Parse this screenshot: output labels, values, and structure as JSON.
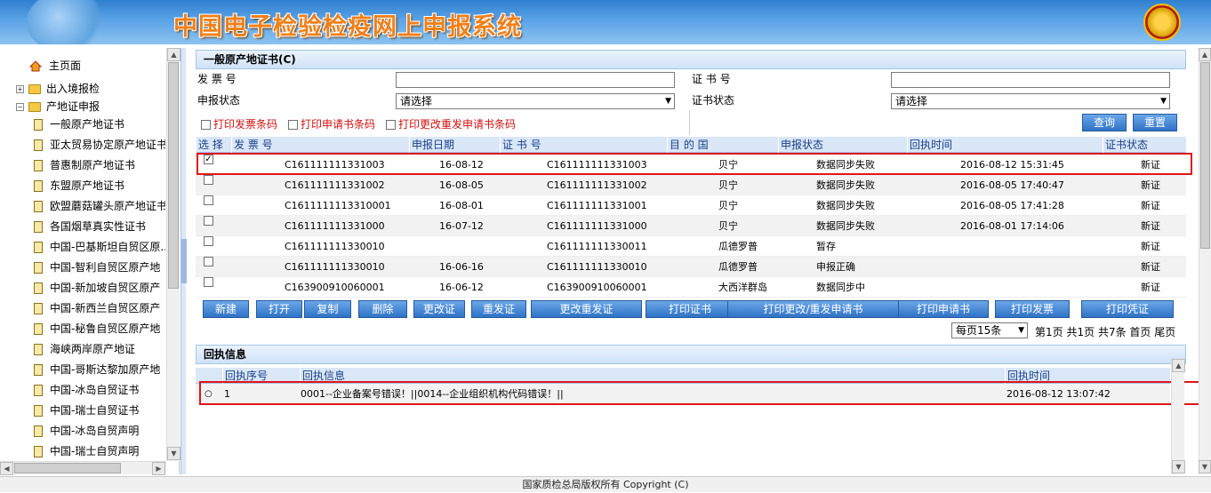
{
  "app": {
    "title": "中国电子检验检疫网上申报系统"
  },
  "sidebar": {
    "items": [
      {
        "label": "主页面"
      },
      {
        "label": "出入境报检"
      },
      {
        "label": "产地证申报"
      },
      {
        "label": "一般原产地证书"
      },
      {
        "label": "亚太贸易协定原产地证书"
      },
      {
        "label": "普惠制原产地证书"
      },
      {
        "label": "东盟原产地证书"
      },
      {
        "label": "欧盟蘑菇罐头原产地证书"
      },
      {
        "label": "各国烟草真实性证书"
      },
      {
        "label": "中国-巴基斯坦自贸区原..."
      },
      {
        "label": "中国-智利自贸区原产地"
      },
      {
        "label": "中国-新加坡自贸区原产"
      },
      {
        "label": "中国-新西兰自贸区原产"
      },
      {
        "label": "中国-秘鲁自贸区原产地"
      },
      {
        "label": "海峡两岸原产地证"
      },
      {
        "label": "中国-哥斯达黎加原产地"
      },
      {
        "label": "中国-冰岛自贸证书"
      },
      {
        "label": "中国-瑞士自贸证书"
      },
      {
        "label": "中国-冰岛自贸声明"
      },
      {
        "label": "中国-瑞士自贸声明"
      }
    ]
  },
  "form": {
    "panel_title": "一般原产地证书(C)",
    "invoice_label": "发 票 号",
    "invoice_value": "",
    "cert_label": "证 书 号",
    "cert_value": "",
    "apply_status_label": "申报状态",
    "apply_status_value": "请选择",
    "cert_status_label": "证书状态",
    "cert_status_value": "请选择",
    "print_invoice_barcode": "打印发票条码",
    "print_apply_barcode": "打印申请书条码",
    "print_change_barcode": "打印更改重发申请书条码",
    "query_button": "查询",
    "reset_button": "重置"
  },
  "table": {
    "headers": [
      "选 择",
      "发 票 号",
      "申报日期",
      "证 书 号",
      "目 的 国",
      "申报状态",
      "回执时间",
      "证书状态"
    ],
    "rows": [
      {
        "checked": true,
        "invoice": "C161111111331003",
        "date": "16-08-12",
        "cert": "C161111111331003",
        "country": "贝宁",
        "status": "数据同步失败",
        "time": "2016-08-12 15:31:45",
        "cert_status": "新证"
      },
      {
        "checked": false,
        "invoice": "C161111111331002",
        "date": "16-08-05",
        "cert": "C161111111331002",
        "country": "贝宁",
        "status": "数据同步失败",
        "time": "2016-08-05 17:40:47",
        "cert_status": "新证"
      },
      {
        "checked": false,
        "invoice": "C1611111113310001",
        "date": "16-08-01",
        "cert": "C161111111331001",
        "country": "贝宁",
        "status": "数据同步失败",
        "time": "2016-08-05 17:41:28",
        "cert_status": "新证"
      },
      {
        "checked": false,
        "invoice": "C161111111331000",
        "date": "16-07-12",
        "cert": "C161111111331000",
        "country": "贝宁",
        "status": "数据同步失败",
        "time": "2016-08-01 17:14:06",
        "cert_status": "新证"
      },
      {
        "checked": false,
        "invoice": "C161111111330010",
        "date": "",
        "cert": "C161111111330011",
        "country": "瓜德罗普",
        "status": "暂存",
        "time": "",
        "cert_status": "新证"
      },
      {
        "checked": false,
        "invoice": "C161111111330010",
        "date": "16-06-16",
        "cert": "C161111111330010",
        "country": "瓜德罗普",
        "status": "申报正确",
        "time": "",
        "cert_status": "新证"
      },
      {
        "checked": false,
        "invoice": "C163900910060001",
        "date": "16-06-12",
        "cert": "C163900910060001",
        "country": "大西洋群岛",
        "status": "数据同步中",
        "time": "",
        "cert_status": "新证"
      }
    ]
  },
  "actions": [
    "新建",
    "打开",
    "复制",
    "删除",
    "更改证",
    "重发证",
    "更改重发证",
    "打印证书",
    "打印更改/重发申请书",
    "打印申请书",
    "打印发票",
    "打印凭证"
  ],
  "pager": {
    "page_size": "每页15条",
    "current": "第1页",
    "total_pages": "共1页",
    "total_records": "共7条",
    "first": "首页",
    "last": "尾页"
  },
  "receipt": {
    "panel_title": "回执信息",
    "headers": [
      "回执序号",
      "回执信息",
      "回执时间"
    ],
    "rows": [
      {
        "seq": "1",
        "info": "0001--企业备案号错误！||0014--企业组织机构代码错误！||",
        "time": "2016-08-12 13:07:42"
      }
    ]
  },
  "footer": {
    "text": "国家质检总局版权所有 Copyright (C)"
  }
}
